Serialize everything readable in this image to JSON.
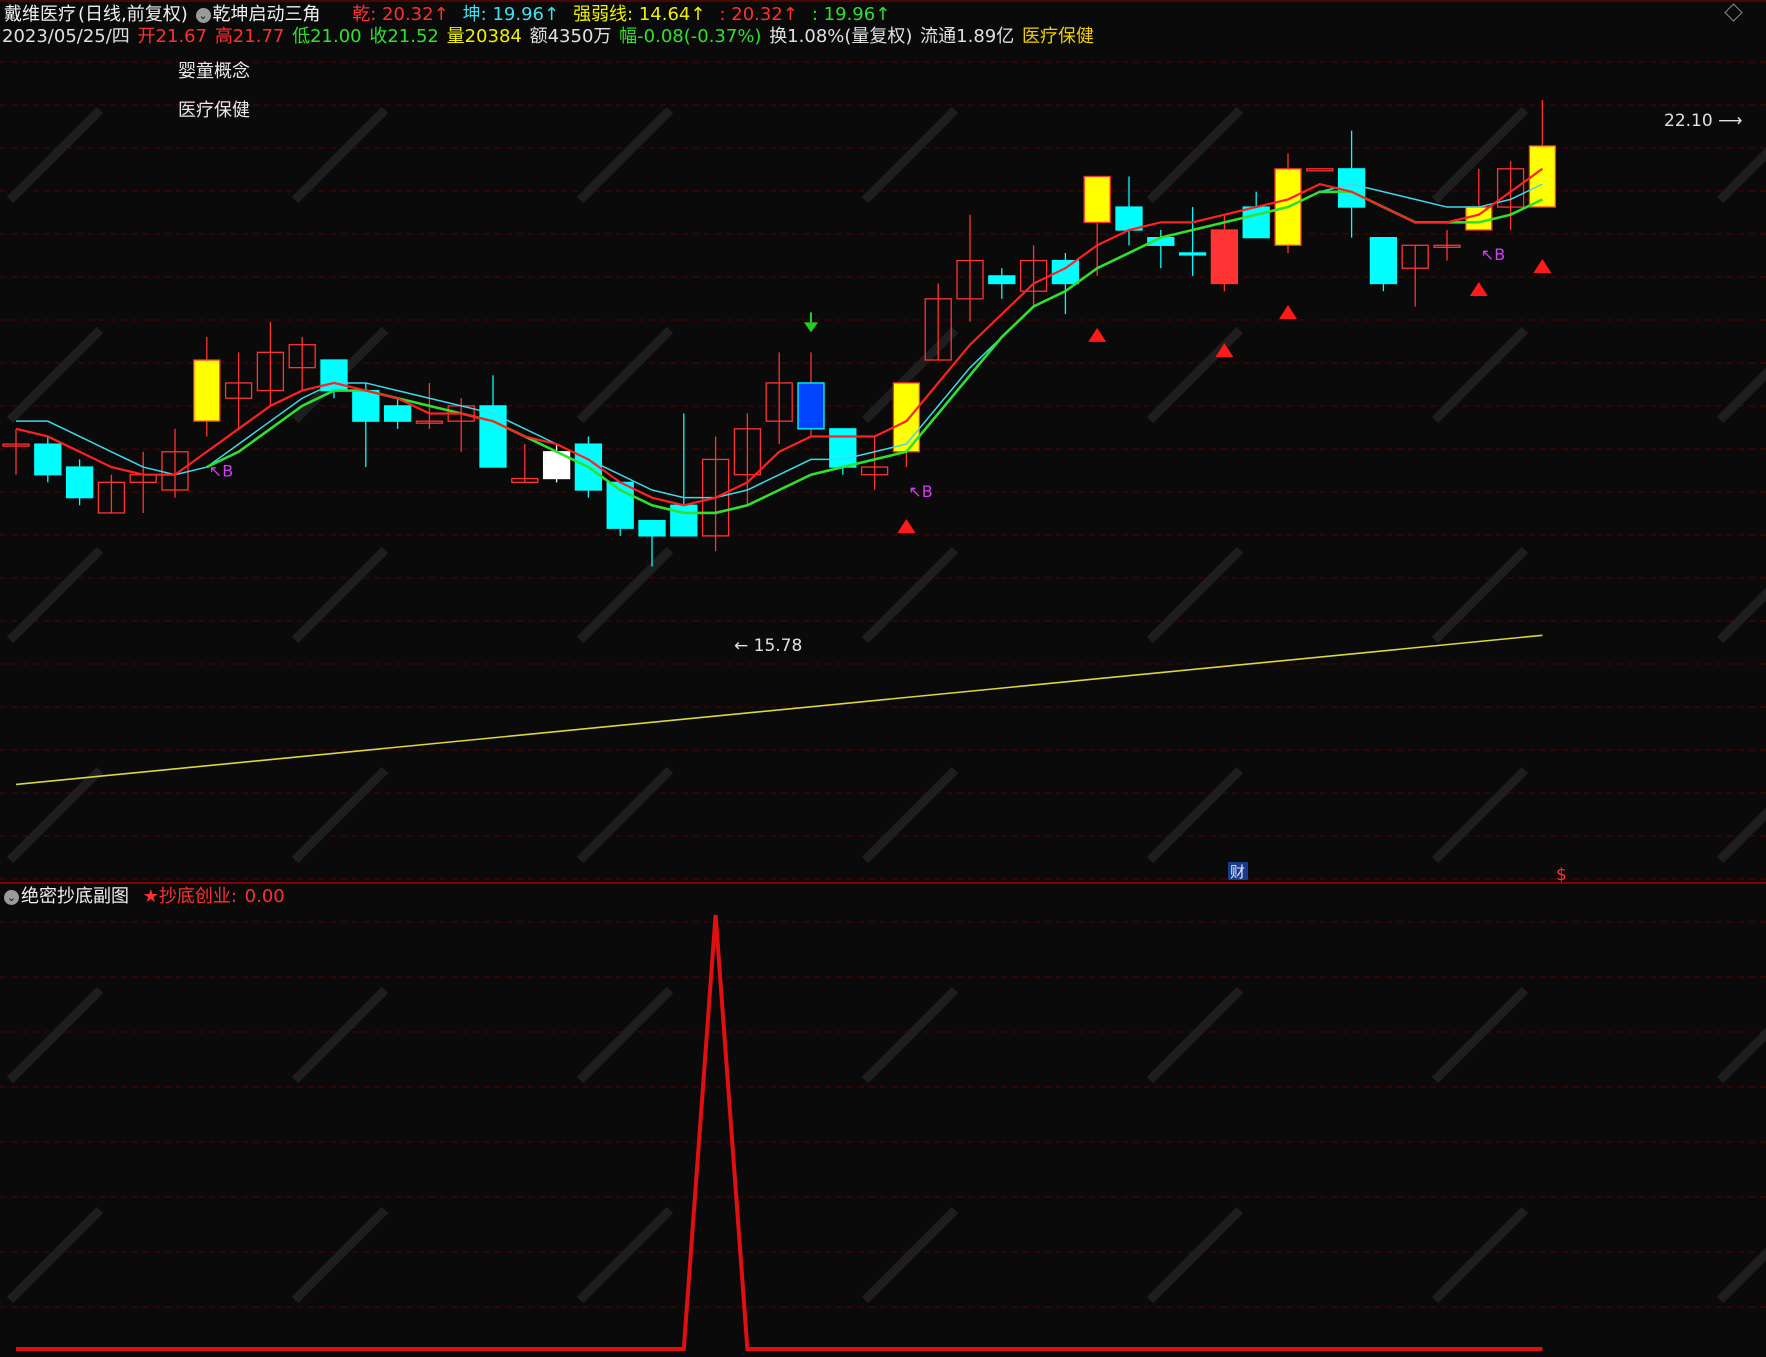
{
  "header": {
    "stock_name": "戴维医疗",
    "period": "(日线,前复权)",
    "indicator_name": "乾坤启动三角",
    "indicator_values": [
      {
        "label": "乾:",
        "value": "20.32↑",
        "color": "#ff3030"
      },
      {
        "label": "坤:",
        "value": "19.96↑",
        "color": "#40e0f0"
      },
      {
        "label": "强弱线:",
        "value": "14.64↑",
        "color": "#f0f000"
      },
      {
        "label": ":",
        "value": "20.32↑",
        "color": "#ff3030"
      },
      {
        "label": ":",
        "value": "19.96↑",
        "color": "#30e030"
      }
    ]
  },
  "quote_line": {
    "date": "2023/05/25/四",
    "open": "开21.67",
    "high": "高21.77",
    "low": "低21.00",
    "close": "收21.52",
    "volume": "量20384",
    "amount": "额4350万",
    "change": "幅-0.08(-0.37%)",
    "turnover": "换1.08%(量复权)",
    "float": "流通1.89亿",
    "sector": "医疗保健"
  },
  "concepts": [
    "婴童概念",
    "医疗保健"
  ],
  "annotations": {
    "high_label": "22.10",
    "low_label": "15.78",
    "buy_mark": "↖B",
    "fin_badge": "财",
    "dollar_badge": "$"
  },
  "sub_panel": {
    "title": "绝密抄底副图",
    "indicator_label": "★抄底创业:",
    "indicator_value": "0.00"
  },
  "colors": {
    "up": "#ff3333",
    "down": "#00ffff",
    "yellow_bar": "#ffff00",
    "blue_bar": "#0044ff",
    "ma_fast": "#ff2020",
    "ma_slow": "#30e030",
    "ma_cyan": "#40d8e8",
    "strength_line": "#d8d840",
    "grid": "#5a0000"
  },
  "chart_data": {
    "type": "candlestick",
    "price_range": [
      14.5,
      23.0
    ],
    "candles": [
      {
        "o": 18.5,
        "h": 18.7,
        "l": 18.1,
        "c": 18.5,
        "style": "up"
      },
      {
        "o": 18.5,
        "h": 18.6,
        "l": 18.0,
        "c": 18.1,
        "style": "down"
      },
      {
        "o": 18.2,
        "h": 18.3,
        "l": 17.7,
        "c": 17.8,
        "style": "down"
      },
      {
        "o": 17.6,
        "h": 18.1,
        "l": 17.6,
        "c": 18.0,
        "style": "up"
      },
      {
        "o": 18.0,
        "h": 18.4,
        "l": 17.6,
        "c": 18.1,
        "style": "up"
      },
      {
        "o": 17.9,
        "h": 18.7,
        "l": 17.8,
        "c": 18.4,
        "style": "up"
      },
      {
        "o": 18.8,
        "h": 19.9,
        "l": 18.6,
        "c": 19.6,
        "style": "yellow"
      },
      {
        "o": 19.1,
        "h": 19.7,
        "l": 18.7,
        "c": 19.3,
        "style": "up"
      },
      {
        "o": 19.2,
        "h": 20.1,
        "l": 19.0,
        "c": 19.7,
        "style": "up"
      },
      {
        "o": 19.5,
        "h": 19.9,
        "l": 19.2,
        "c": 19.8,
        "style": "up"
      },
      {
        "o": 19.6,
        "h": 19.6,
        "l": 19.1,
        "c": 19.2,
        "style": "down"
      },
      {
        "o": 19.2,
        "h": 19.3,
        "l": 18.2,
        "c": 18.8,
        "style": "down"
      },
      {
        "o": 19.0,
        "h": 19.1,
        "l": 18.7,
        "c": 18.8,
        "style": "down"
      },
      {
        "o": 18.8,
        "h": 19.3,
        "l": 18.7,
        "c": 18.8,
        "style": "up"
      },
      {
        "o": 18.8,
        "h": 19.1,
        "l": 18.4,
        "c": 19.0,
        "style": "up"
      },
      {
        "o": 19.0,
        "h": 19.4,
        "l": 18.2,
        "c": 18.2,
        "style": "down"
      },
      {
        "o": 18.0,
        "h": 18.5,
        "l": 18.0,
        "c": 18.05,
        "style": "up"
      },
      {
        "o": 18.4,
        "h": 18.5,
        "l": 18.0,
        "c": 18.05,
        "style": "cross"
      },
      {
        "o": 18.5,
        "h": 18.6,
        "l": 17.8,
        "c": 17.9,
        "style": "down"
      },
      {
        "o": 18.0,
        "h": 18.0,
        "l": 17.3,
        "c": 17.4,
        "style": "down"
      },
      {
        "o": 17.5,
        "h": 17.5,
        "l": 16.9,
        "c": 17.3,
        "style": "down"
      },
      {
        "o": 17.7,
        "h": 18.9,
        "l": 17.3,
        "c": 17.3,
        "style": "down"
      },
      {
        "o": 17.3,
        "h": 18.6,
        "l": 17.1,
        "c": 18.3,
        "style": "up"
      },
      {
        "o": 18.1,
        "h": 18.9,
        "l": 17.7,
        "c": 18.7,
        "style": "up"
      },
      {
        "o": 18.8,
        "h": 19.7,
        "l": 18.5,
        "c": 19.3,
        "style": "up"
      },
      {
        "o": 19.3,
        "h": 19.7,
        "l": 18.6,
        "c": 18.7,
        "style": "blue"
      },
      {
        "o": 18.7,
        "h": 18.7,
        "l": 18.1,
        "c": 18.2,
        "style": "down"
      },
      {
        "o": 18.1,
        "h": 18.6,
        "l": 17.9,
        "c": 18.2,
        "style": "up"
      },
      {
        "o": 18.4,
        "h": 19.3,
        "l": 18.2,
        "c": 19.3,
        "style": "yellow"
      },
      {
        "o": 19.6,
        "h": 20.6,
        "l": 19.6,
        "c": 20.4,
        "style": "up"
      },
      {
        "o": 20.4,
        "h": 21.5,
        "l": 20.1,
        "c": 20.9,
        "style": "up"
      },
      {
        "o": 20.7,
        "h": 20.8,
        "l": 20.4,
        "c": 20.6,
        "style": "down"
      },
      {
        "o": 20.5,
        "h": 21.1,
        "l": 20.3,
        "c": 20.9,
        "style": "up"
      },
      {
        "o": 20.9,
        "h": 21.0,
        "l": 20.2,
        "c": 20.6,
        "style": "down"
      },
      {
        "o": 21.4,
        "h": 21.9,
        "l": 20.7,
        "c": 22.0,
        "style": "yellow"
      },
      {
        "o": 21.6,
        "h": 22.0,
        "l": 21.1,
        "c": 21.3,
        "style": "down"
      },
      {
        "o": 21.2,
        "h": 21.3,
        "l": 20.8,
        "c": 21.1,
        "style": "down"
      },
      {
        "o": 21.0,
        "h": 21.6,
        "l": 20.7,
        "c": 21.0,
        "style": "down"
      },
      {
        "o": 20.6,
        "h": 21.5,
        "l": 20.5,
        "c": 21.3,
        "style": "red"
      },
      {
        "o": 21.6,
        "h": 21.8,
        "l": 21.3,
        "c": 21.2,
        "style": "down"
      },
      {
        "o": 21.1,
        "h": 22.3,
        "l": 21.0,
        "c": 22.1,
        "style": "yellow"
      },
      {
        "o": 22.1,
        "h": 22.0,
        "l": 22.0,
        "c": 22.1,
        "style": "up"
      },
      {
        "o": 22.1,
        "h": 22.6,
        "l": 21.2,
        "c": 21.6,
        "style": "down"
      },
      {
        "o": 21.2,
        "h": 21.2,
        "l": 20.5,
        "c": 20.6,
        "style": "down"
      },
      {
        "o": 20.8,
        "h": 21.1,
        "l": 20.3,
        "c": 21.1,
        "style": "up"
      },
      {
        "o": 21.1,
        "h": 21.3,
        "l": 20.9,
        "c": 21.1,
        "style": "up"
      },
      {
        "o": 21.3,
        "h": 22.1,
        "l": 21.3,
        "c": 21.6,
        "style": "yellow"
      },
      {
        "o": 21.6,
        "h": 22.2,
        "l": 21.3,
        "c": 22.1,
        "style": "up"
      },
      {
        "o": 21.6,
        "h": 23.0,
        "l": 21.6,
        "c": 22.4,
        "style": "yellow"
      }
    ],
    "ma_fast": [
      18.7,
      18.6,
      18.4,
      18.2,
      18.1,
      18.1,
      18.4,
      18.7,
      19.0,
      19.2,
      19.3,
      19.2,
      19.1,
      18.9,
      18.9,
      18.8,
      18.6,
      18.5,
      18.3,
      18.0,
      17.8,
      17.7,
      17.8,
      18.0,
      18.4,
      18.6,
      18.6,
      18.6,
      18.8,
      19.3,
      19.8,
      20.2,
      20.6,
      20.8,
      21.1,
      21.3,
      21.4,
      21.4,
      21.5,
      21.6,
      21.7,
      21.9,
      21.8,
      21.6,
      21.4,
      21.4,
      21.5,
      21.8,
      22.1
    ],
    "ma_slow": [
      null,
      null,
      null,
      null,
      null,
      null,
      18.2,
      18.4,
      18.7,
      19.0,
      19.2,
      19.2,
      19.1,
      19.0,
      18.9,
      18.8,
      18.6,
      18.4,
      18.2,
      17.9,
      17.7,
      17.6,
      17.6,
      17.7,
      17.9,
      18.1,
      18.2,
      18.3,
      18.4,
      18.9,
      19.4,
      19.9,
      20.3,
      20.5,
      20.8,
      21.0,
      21.2,
      21.3,
      21.4,
      21.5,
      21.6,
      21.8,
      21.8,
      21.6,
      21.4,
      21.4,
      21.4,
      21.5,
      21.7
    ],
    "ma_cyan": [
      18.8,
      18.8,
      18.6,
      18.4,
      18.2,
      18.1,
      18.2,
      18.5,
      18.8,
      19.1,
      19.3,
      19.3,
      19.2,
      19.1,
      19.0,
      18.9,
      18.7,
      18.5,
      18.3,
      18.1,
      17.9,
      17.8,
      17.8,
      17.9,
      18.1,
      18.3,
      18.3,
      18.4,
      18.5,
      19.0,
      19.5,
      19.9,
      20.3,
      20.5,
      20.8,
      21.0,
      21.2,
      21.3,
      21.4,
      21.5,
      21.6,
      21.8,
      21.9,
      21.8,
      21.7,
      21.6,
      21.6,
      21.7,
      21.9
    ],
    "signal_triangles": [
      28,
      34,
      38,
      40,
      46,
      48
    ],
    "buy_marks": [
      6,
      28,
      46
    ],
    "down_arrow_index": 25,
    "strength_line": {
      "start": 14.05,
      "end": 16.0
    },
    "sub_indicator": {
      "x_range": [
        0,
        48
      ],
      "points": [
        [
          0,
          0
        ],
        [
          21,
          0
        ],
        [
          22,
          1
        ],
        [
          23,
          0
        ],
        [
          48,
          0
        ]
      ],
      "ylim": [
        0,
        1
      ]
    }
  }
}
